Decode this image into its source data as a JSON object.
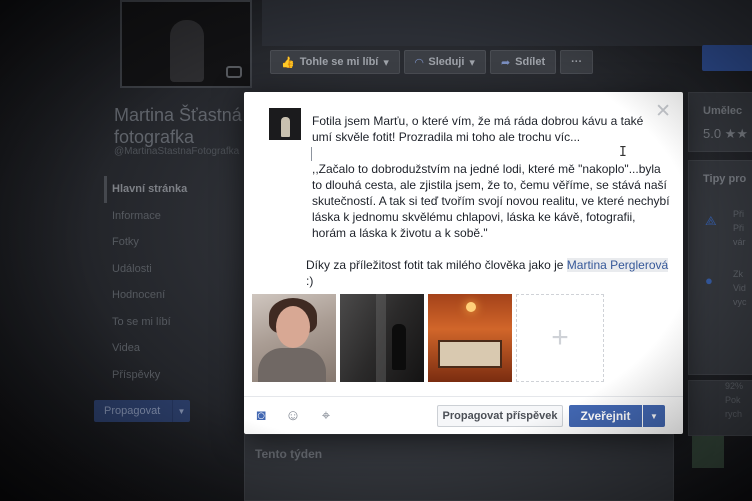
{
  "background": {
    "actions": [
      {
        "icon": "thumbs-up-icon",
        "label": "Tohle se mi líbí"
      },
      {
        "icon": "rss-icon",
        "label": "Sleduji"
      },
      {
        "icon": "share-icon",
        "label": "Sdílet"
      },
      {
        "icon": "more-icon",
        "label": "···"
      }
    ],
    "page_name": "Martina Šťastná - fotografka",
    "page_handle": "@MartinaStastnaFotografka",
    "nav": [
      "Hlavní stránka",
      "Informace",
      "Fotky",
      "Události",
      "Hodnocení",
      "To se mi líbí",
      "Videa",
      "Příspěvky"
    ],
    "promote_label": "Propagovat",
    "right_panel": {
      "category": "Umělec",
      "rating": "5.0 ★★",
      "tips_title": "Tipy pro",
      "tip_snippets": [
        "Při",
        "Při",
        "vár",
        "Zk",
        "Vid",
        "vyc"
      ],
      "stat": "92%",
      "stat_snippets": [
        "Pok",
        "rych"
      ]
    },
    "week_title": "Tento týden"
  },
  "composer": {
    "close_icon": "close-icon",
    "paragraphs": [
      "Fotila jsem Marťu, o které vím, že má ráda dobrou kávu a také umí skvěle fotit! Prozradila mi toho ale trochu víc...",
      ",,Začalo to dobrodužstvím na jedné lodi, které mě \"nakoplo\"...byla to dlouhá cesta, ale zjistila jsem, že to, čemu věříme, se stává naší skutečností. A tak si teď tvořím svojí novou realitu, ve které nechybí láska k jednomu skvělému chlapovi, láska ke kávě, fotografii, horám a láska k životu a k sobě.\""
    ],
    "closing_text": "Díky za příležitost fotit tak milého člověka jako je ",
    "mention": "Martina Perglerová",
    "closing_end": " :)",
    "add_photo_glyph": "+",
    "toolbar_icons": [
      "camera-icon",
      "smile-icon",
      "location-pin-icon"
    ],
    "boost_label": "Propagovat příspěvek",
    "publish_label": "Zveřejnit"
  },
  "colors": {
    "facebook_blue": "#4267b2",
    "mention_bg": "#e9ebee",
    "mention_text": "#365899"
  }
}
